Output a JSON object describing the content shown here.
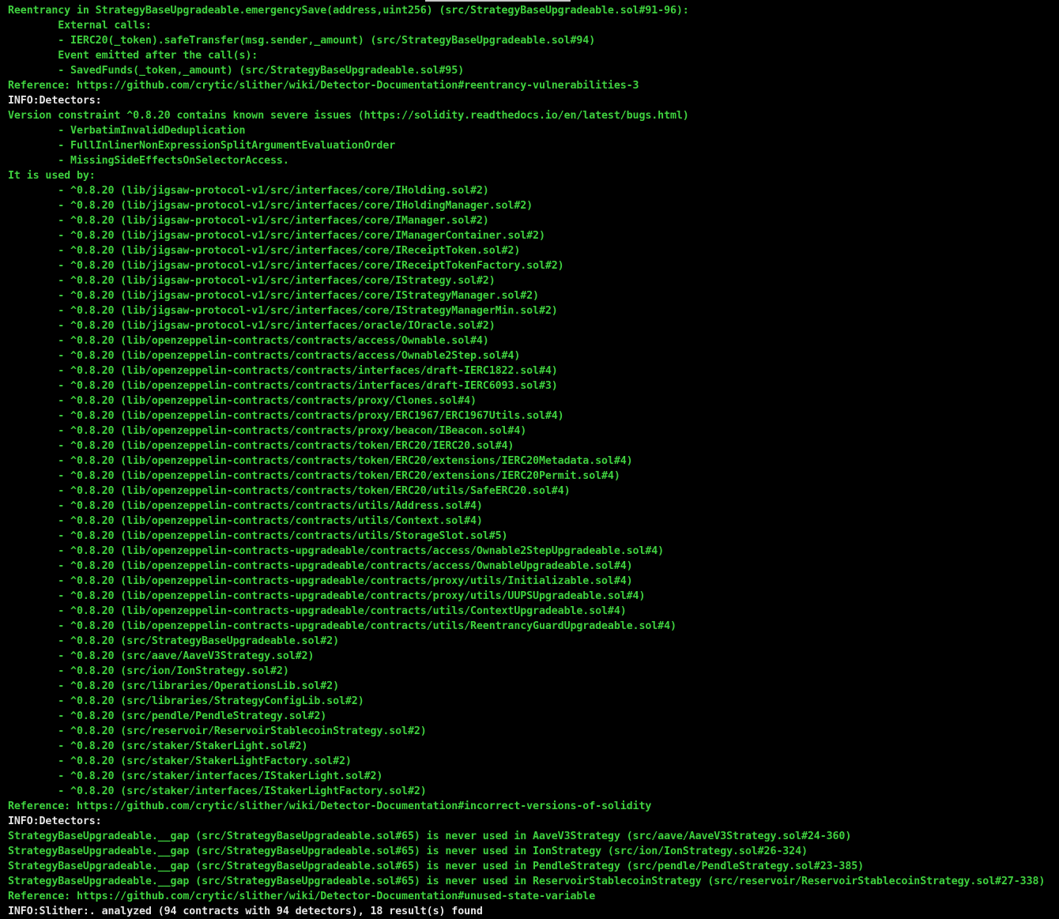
{
  "colors": {
    "background": "#000000",
    "green_text": "#3fd23f",
    "info_text": "#e6e6e6"
  },
  "lines": [
    {
      "text": "Reentrancy in StrategyBaseUpgradeable.emergencySave(address,uint256) (src/StrategyBaseUpgradeable.sol#91-96):",
      "style": "green"
    },
    {
      "text": "\tExternal calls:",
      "style": "green"
    },
    {
      "text": "\t- IERC20(_token).safeTransfer(msg.sender,_amount) (src/StrategyBaseUpgradeable.sol#94)",
      "style": "green"
    },
    {
      "text": "\tEvent emitted after the call(s):",
      "style": "green"
    },
    {
      "text": "\t- SavedFunds(_token,_amount) (src/StrategyBaseUpgradeable.sol#95)",
      "style": "green"
    },
    {
      "text": "Reference: https://github.com/crytic/slither/wiki/Detector-Documentation#reentrancy-vulnerabilities-3",
      "style": "green"
    },
    {
      "text": "INFO:Detectors:",
      "style": "white"
    },
    {
      "text": "Version constraint ^0.8.20 contains known severe issues (https://solidity.readthedocs.io/en/latest/bugs.html)",
      "style": "green"
    },
    {
      "text": "\t- VerbatimInvalidDeduplication",
      "style": "green"
    },
    {
      "text": "\t- FullInlinerNonExpressionSplitArgumentEvaluationOrder",
      "style": "green"
    },
    {
      "text": "\t- MissingSideEffectsOnSelectorAccess.",
      "style": "green"
    },
    {
      "text": "It is used by:",
      "style": "green"
    },
    {
      "text": "\t- ^0.8.20 (lib/jigsaw-protocol-v1/src/interfaces/core/IHolding.sol#2)",
      "style": "green"
    },
    {
      "text": "\t- ^0.8.20 (lib/jigsaw-protocol-v1/src/interfaces/core/IHoldingManager.sol#2)",
      "style": "green"
    },
    {
      "text": "\t- ^0.8.20 (lib/jigsaw-protocol-v1/src/interfaces/core/IManager.sol#2)",
      "style": "green"
    },
    {
      "text": "\t- ^0.8.20 (lib/jigsaw-protocol-v1/src/interfaces/core/IManagerContainer.sol#2)",
      "style": "green"
    },
    {
      "text": "\t- ^0.8.20 (lib/jigsaw-protocol-v1/src/interfaces/core/IReceiptToken.sol#2)",
      "style": "green"
    },
    {
      "text": "\t- ^0.8.20 (lib/jigsaw-protocol-v1/src/interfaces/core/IReceiptTokenFactory.sol#2)",
      "style": "green"
    },
    {
      "text": "\t- ^0.8.20 (lib/jigsaw-protocol-v1/src/interfaces/core/IStrategy.sol#2)",
      "style": "green"
    },
    {
      "text": "\t- ^0.8.20 (lib/jigsaw-protocol-v1/src/interfaces/core/IStrategyManager.sol#2)",
      "style": "green"
    },
    {
      "text": "\t- ^0.8.20 (lib/jigsaw-protocol-v1/src/interfaces/core/IStrategyManagerMin.sol#2)",
      "style": "green"
    },
    {
      "text": "\t- ^0.8.20 (lib/jigsaw-protocol-v1/src/interfaces/oracle/IOracle.sol#2)",
      "style": "green"
    },
    {
      "text": "\t- ^0.8.20 (lib/openzeppelin-contracts/contracts/access/Ownable.sol#4)",
      "style": "green"
    },
    {
      "text": "\t- ^0.8.20 (lib/openzeppelin-contracts/contracts/access/Ownable2Step.sol#4)",
      "style": "green"
    },
    {
      "text": "\t- ^0.8.20 (lib/openzeppelin-contracts/contracts/interfaces/draft-IERC1822.sol#4)",
      "style": "green"
    },
    {
      "text": "\t- ^0.8.20 (lib/openzeppelin-contracts/contracts/interfaces/draft-IERC6093.sol#3)",
      "style": "green"
    },
    {
      "text": "\t- ^0.8.20 (lib/openzeppelin-contracts/contracts/proxy/Clones.sol#4)",
      "style": "green"
    },
    {
      "text": "\t- ^0.8.20 (lib/openzeppelin-contracts/contracts/proxy/ERC1967/ERC1967Utils.sol#4)",
      "style": "green"
    },
    {
      "text": "\t- ^0.8.20 (lib/openzeppelin-contracts/contracts/proxy/beacon/IBeacon.sol#4)",
      "style": "green"
    },
    {
      "text": "\t- ^0.8.20 (lib/openzeppelin-contracts/contracts/token/ERC20/IERC20.sol#4)",
      "style": "green"
    },
    {
      "text": "\t- ^0.8.20 (lib/openzeppelin-contracts/contracts/token/ERC20/extensions/IERC20Metadata.sol#4)",
      "style": "green"
    },
    {
      "text": "\t- ^0.8.20 (lib/openzeppelin-contracts/contracts/token/ERC20/extensions/IERC20Permit.sol#4)",
      "style": "green"
    },
    {
      "text": "\t- ^0.8.20 (lib/openzeppelin-contracts/contracts/token/ERC20/utils/SafeERC20.sol#4)",
      "style": "green"
    },
    {
      "text": "\t- ^0.8.20 (lib/openzeppelin-contracts/contracts/utils/Address.sol#4)",
      "style": "green"
    },
    {
      "text": "\t- ^0.8.20 (lib/openzeppelin-contracts/contracts/utils/Context.sol#4)",
      "style": "green"
    },
    {
      "text": "\t- ^0.8.20 (lib/openzeppelin-contracts/contracts/utils/StorageSlot.sol#5)",
      "style": "green"
    },
    {
      "text": "\t- ^0.8.20 (lib/openzeppelin-contracts-upgradeable/contracts/access/Ownable2StepUpgradeable.sol#4)",
      "style": "green"
    },
    {
      "text": "\t- ^0.8.20 (lib/openzeppelin-contracts-upgradeable/contracts/access/OwnableUpgradeable.sol#4)",
      "style": "green"
    },
    {
      "text": "\t- ^0.8.20 (lib/openzeppelin-contracts-upgradeable/contracts/proxy/utils/Initializable.sol#4)",
      "style": "green"
    },
    {
      "text": "\t- ^0.8.20 (lib/openzeppelin-contracts-upgradeable/contracts/proxy/utils/UUPSUpgradeable.sol#4)",
      "style": "green"
    },
    {
      "text": "\t- ^0.8.20 (lib/openzeppelin-contracts-upgradeable/contracts/utils/ContextUpgradeable.sol#4)",
      "style": "green"
    },
    {
      "text": "\t- ^0.8.20 (lib/openzeppelin-contracts-upgradeable/contracts/utils/ReentrancyGuardUpgradeable.sol#4)",
      "style": "green"
    },
    {
      "text": "\t- ^0.8.20 (src/StrategyBaseUpgradeable.sol#2)",
      "style": "green"
    },
    {
      "text": "\t- ^0.8.20 (src/aave/AaveV3Strategy.sol#2)",
      "style": "green"
    },
    {
      "text": "\t- ^0.8.20 (src/ion/IonStrategy.sol#2)",
      "style": "green"
    },
    {
      "text": "\t- ^0.8.20 (src/libraries/OperationsLib.sol#2)",
      "style": "green"
    },
    {
      "text": "\t- ^0.8.20 (src/libraries/StrategyConfigLib.sol#2)",
      "style": "green"
    },
    {
      "text": "\t- ^0.8.20 (src/pendle/PendleStrategy.sol#2)",
      "style": "green"
    },
    {
      "text": "\t- ^0.8.20 (src/reservoir/ReservoirStablecoinStrategy.sol#2)",
      "style": "green"
    },
    {
      "text": "\t- ^0.8.20 (src/staker/StakerLight.sol#2)",
      "style": "green"
    },
    {
      "text": "\t- ^0.8.20 (src/staker/StakerLightFactory.sol#2)",
      "style": "green"
    },
    {
      "text": "\t- ^0.8.20 (src/staker/interfaces/IStakerLight.sol#2)",
      "style": "green"
    },
    {
      "text": "\t- ^0.8.20 (src/staker/interfaces/IStakerLightFactory.sol#2)",
      "style": "green"
    },
    {
      "text": "Reference: https://github.com/crytic/slither/wiki/Detector-Documentation#incorrect-versions-of-solidity",
      "style": "green"
    },
    {
      "text": "INFO:Detectors:",
      "style": "white"
    },
    {
      "text": "StrategyBaseUpgradeable.__gap (src/StrategyBaseUpgradeable.sol#65) is never used in AaveV3Strategy (src/aave/AaveV3Strategy.sol#24-360)",
      "style": "green"
    },
    {
      "text": "StrategyBaseUpgradeable.__gap (src/StrategyBaseUpgradeable.sol#65) is never used in IonStrategy (src/ion/IonStrategy.sol#26-324)",
      "style": "green"
    },
    {
      "text": "StrategyBaseUpgradeable.__gap (src/StrategyBaseUpgradeable.sol#65) is never used in PendleStrategy (src/pendle/PendleStrategy.sol#23-385)",
      "style": "green"
    },
    {
      "text": "StrategyBaseUpgradeable.__gap (src/StrategyBaseUpgradeable.sol#65) is never used in ReservoirStablecoinStrategy (src/reservoir/ReservoirStablecoinStrategy.sol#27-338)",
      "style": "green"
    },
    {
      "text": "Reference: https://github.com/crytic/slither/wiki/Detector-Documentation#unused-state-variable",
      "style": "green"
    },
    {
      "text": "INFO:Slither:. analyzed (94 contracts with 94 detectors), 18 result(s) found",
      "style": "white"
    }
  ]
}
